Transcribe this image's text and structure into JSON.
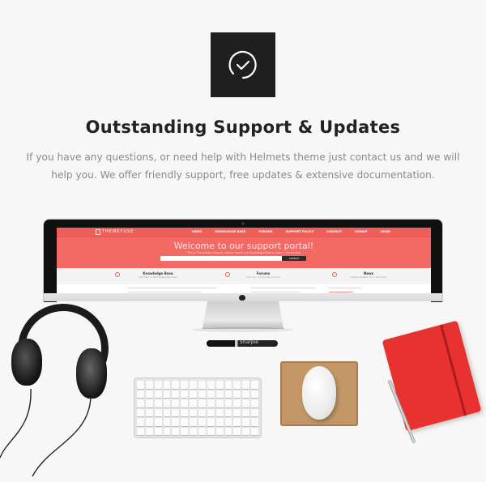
{
  "header": {
    "icon": "clock-check-icon",
    "title": "Outstanding Support & Updates",
    "description": "If you have any questions, or need help with Helmets theme just contact us and we will help you. We offer friendly support, free updates & extensive documentation."
  },
  "screen": {
    "logo": "THEMEFUSE",
    "menu": [
      "VIDEO",
      "KNOWLEDGE BASE",
      "FORUMS",
      "SUPPORT POLICY",
      "CONTACT",
      "SIGNUP",
      "LOGIN"
    ],
    "hero_title": "Welcome to our support portal!",
    "hero_subtitle": "This is ThemeFuse Support, please search our Knowledge Base or post in the forums",
    "search_button": "SEARCH",
    "columns": [
      {
        "title": "Knowledge Base",
        "subtitle": "Get help in the knowledge base"
      },
      {
        "title": "Forums",
        "subtitle": "Visit our community forums"
      },
      {
        "title": "News",
        "subtitle": "Latest updates from the team"
      }
    ]
  },
  "marker_brand": "Sharpie",
  "colors": {
    "background": "#f7f7f7",
    "accent": "#ef5f5a",
    "icon_box": "#1f1f1f",
    "notebook": "#e8322f"
  }
}
